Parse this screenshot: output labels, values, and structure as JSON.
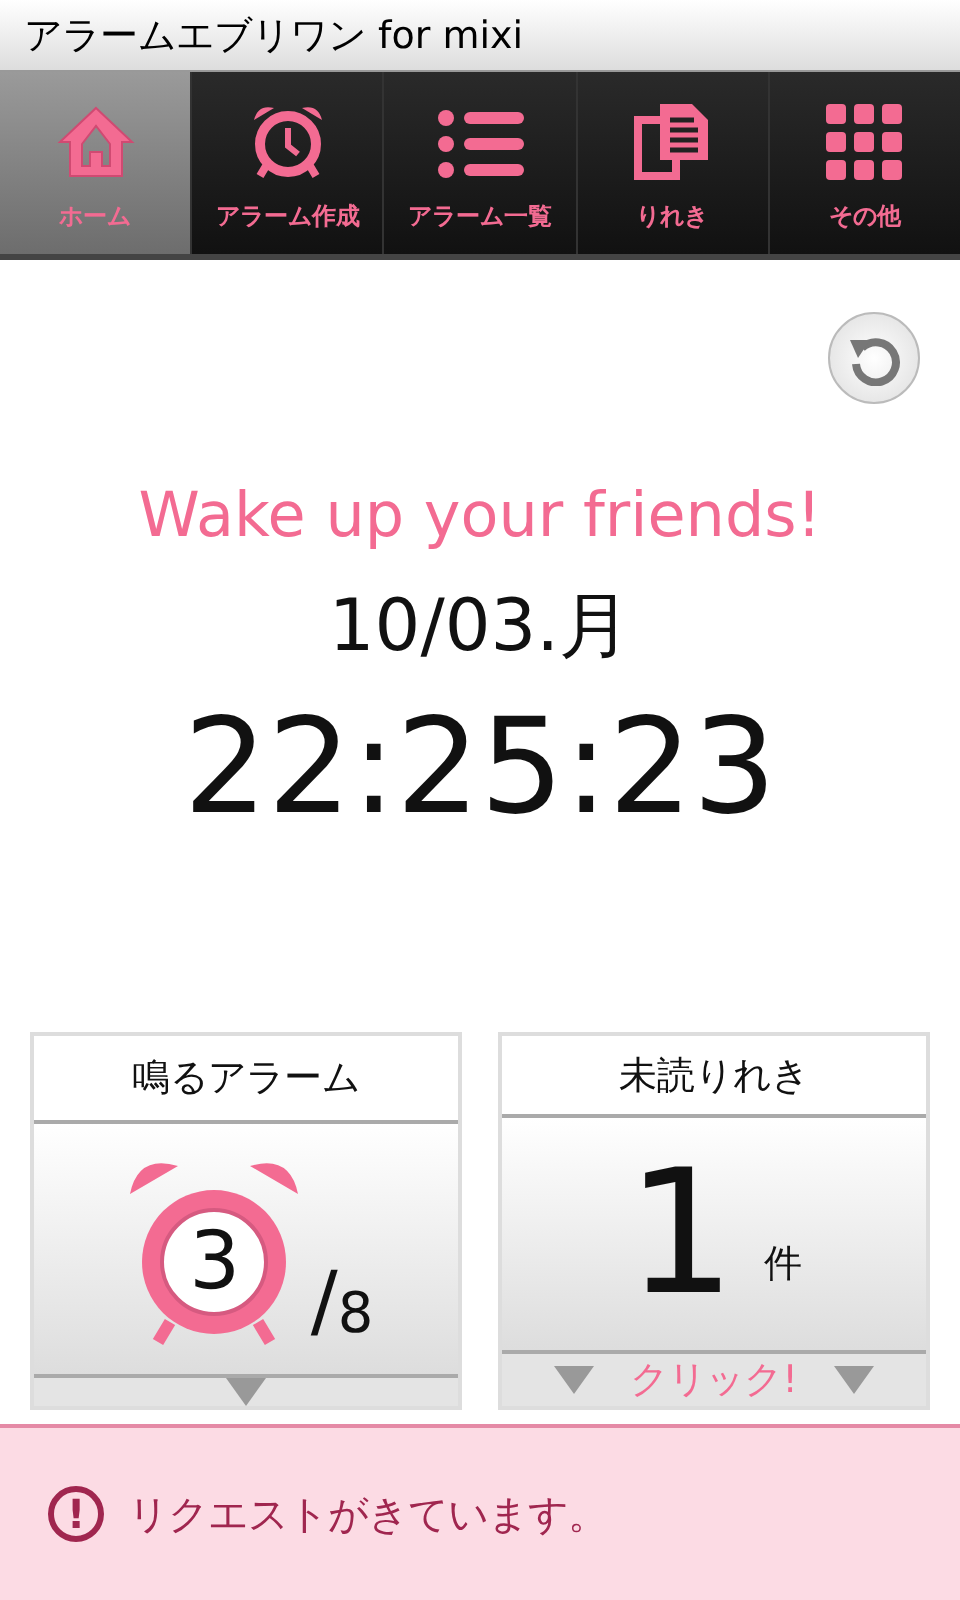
{
  "window": {
    "title": "アラームエブリワン for mixi"
  },
  "tabs": [
    {
      "kind": "home",
      "label": "ホーム",
      "selected": true
    },
    {
      "kind": "alarm",
      "label": "アラーム作成",
      "selected": false
    },
    {
      "kind": "list",
      "label": "アラーム一覧",
      "selected": false
    },
    {
      "kind": "document",
      "label": "りれき",
      "selected": false
    },
    {
      "kind": "grid",
      "label": "その他",
      "selected": false
    }
  ],
  "home": {
    "tagline": "Wake up your friends!",
    "date": "10/03.月",
    "time": "22:25:23"
  },
  "cards": [
    {
      "kind": "alarms",
      "title": "鳴るアラーム",
      "count": "3",
      "separator": "/",
      "total": "8"
    },
    {
      "kind": "history",
      "title": "未読りれき",
      "count": "1",
      "unit": "件",
      "link": "クリック!"
    }
  ],
  "notice": {
    "icon": "!",
    "text": "リクエストがきています。"
  }
}
